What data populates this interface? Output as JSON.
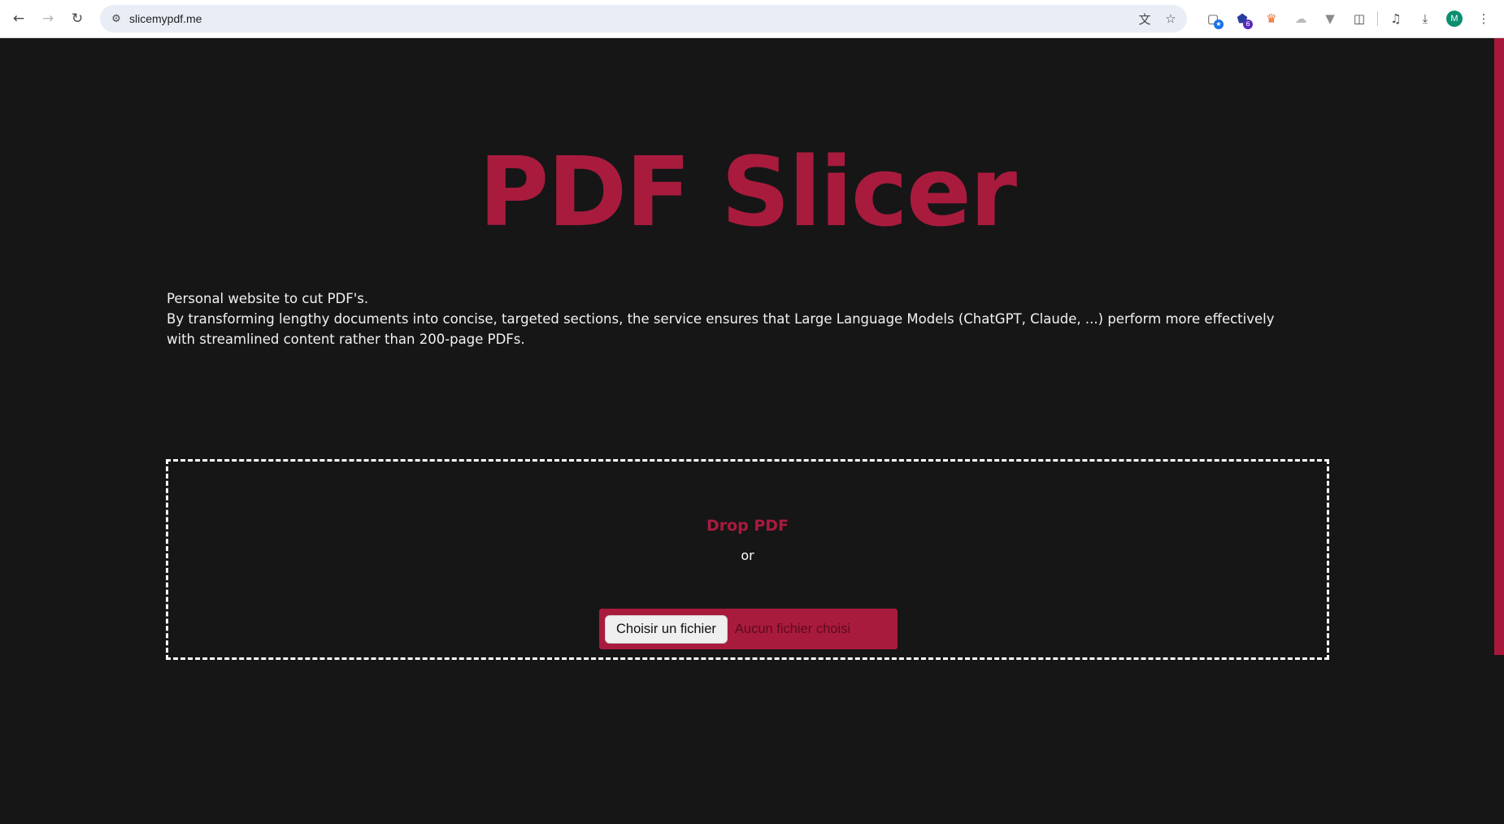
{
  "browser": {
    "url": "slicemypdf.me",
    "extension_badges": {
      "ext2": "6"
    },
    "profile_initial": "M"
  },
  "page": {
    "title": "PDF Slicer",
    "description": [
      "Personal website to cut PDF's.",
      "By transforming lengthy documents into concise, targeted sections, the service ensures that Large Language Models (ChatGPT, Claude, ...) perform more effectively with streamlined content rather than 200-page PDFs."
    ],
    "dropzone": {
      "title": "Drop PDF",
      "separator": "or",
      "file_button": "Choisir un fichier",
      "file_status": "Aucun fichier choisi"
    }
  },
  "colors": {
    "accent": "#a91b3d",
    "background": "#161617",
    "text": "#f2f2f2"
  }
}
